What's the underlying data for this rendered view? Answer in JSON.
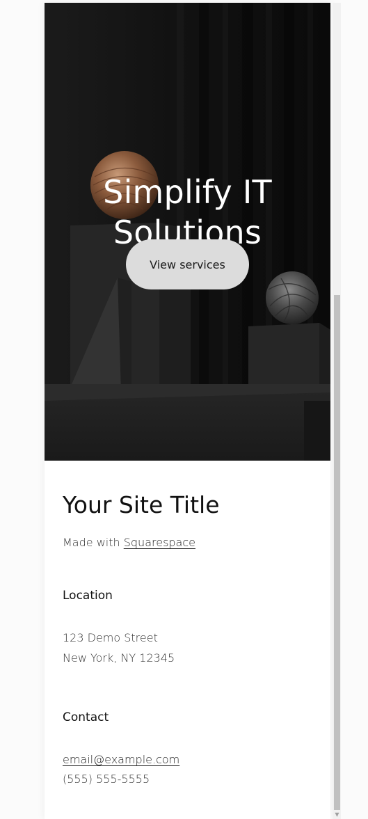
{
  "hero": {
    "title_line1": "Simplify IT",
    "title_line2": "Solutions",
    "button_label": "View services",
    "image_icon": "sculpture-scene-image"
  },
  "info": {
    "site_title": "Your Site Title",
    "made_with_prefix": "Made with ",
    "made_with_link": "Squarespace",
    "location_heading": "Location",
    "address_line1": "123 Demo Street",
    "address_line2": "New York, NY 12345",
    "contact_heading": "Contact",
    "email": "email@example.com",
    "phone": "(555) 555-5555"
  },
  "scrollbar": {
    "down_arrow_icon": "scroll-down-arrow-icon",
    "down_arrow_glyph": "▼"
  },
  "colors": {
    "page_background": "#fbfbfb",
    "hero_background": "#161616",
    "button_background": "#dcdcdc",
    "text_dark": "#111111"
  }
}
